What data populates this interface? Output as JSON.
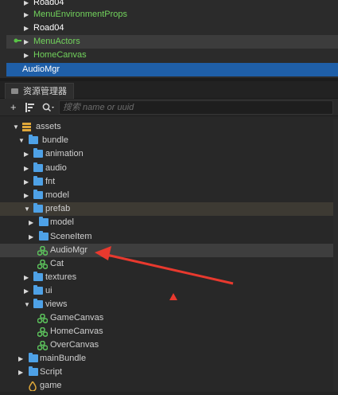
{
  "hierarchy": {
    "rows": [
      {
        "label": "Road04",
        "color": "white",
        "arrow": "▶"
      },
      {
        "label": "MenuEnvironmentProps",
        "color": "green",
        "arrow": "▶"
      },
      {
        "label": "Road04",
        "color": "white",
        "arrow": "▶"
      },
      {
        "label": "MenuActors",
        "color": "green",
        "arrow": "▶",
        "locked": true,
        "state": "hover"
      },
      {
        "label": "HomeCanvas",
        "color": "green",
        "arrow": "▶"
      },
      {
        "label": "AudioMgr",
        "color": "white",
        "arrow": "",
        "state": "selected"
      }
    ]
  },
  "assets_panel": {
    "tab_label": "资源管理器",
    "toolbar": {
      "add_icon": "+",
      "sort_icon": "sort-icon",
      "search_icon": "search-icon",
      "search_placeholder": "搜索 name or uuid"
    },
    "tree": [
      {
        "label": "assets",
        "icon": "database-icon",
        "expanded": true
      },
      {
        "label": "bundle",
        "icon": "folder-icon",
        "expanded": true
      },
      {
        "label": "animation",
        "icon": "folder-icon",
        "expanded": false
      },
      {
        "label": "audio",
        "icon": "folder-icon",
        "expanded": false
      },
      {
        "label": "fnt",
        "icon": "folder-icon",
        "expanded": false
      },
      {
        "label": "model",
        "icon": "folder-icon",
        "expanded": false
      },
      {
        "label": "prefab",
        "icon": "folder-icon",
        "expanded": true,
        "state": "highlight"
      },
      {
        "label": "model",
        "icon": "folder-icon",
        "expanded": false
      },
      {
        "label": "SceneItem",
        "icon": "folder-icon",
        "expanded": false
      },
      {
        "label": "AudioMgr",
        "icon": "prefab-icon",
        "state": "hover"
      },
      {
        "label": "Cat",
        "icon": "prefab-icon"
      },
      {
        "label": "textures",
        "icon": "folder-icon",
        "expanded": false
      },
      {
        "label": "ui",
        "icon": "folder-icon",
        "expanded": false
      },
      {
        "label": "views",
        "icon": "folder-icon",
        "expanded": true
      },
      {
        "label": "GameCanvas",
        "icon": "prefab-icon"
      },
      {
        "label": "HomeCanvas",
        "icon": "prefab-icon"
      },
      {
        "label": "OverCanvas",
        "icon": "prefab-icon"
      },
      {
        "label": "mainBundle",
        "icon": "folder-icon",
        "expanded": false
      },
      {
        "label": "Script",
        "icon": "folder-icon",
        "expanded": false
      },
      {
        "label": "game",
        "icon": "game-icon"
      }
    ]
  },
  "colors": {
    "selection": "#1f5fa8",
    "folder": "#4ea1e6",
    "prefab": "#5cc25c",
    "annotation_arrow": "#e8392e",
    "node_green": "#72d35c"
  }
}
